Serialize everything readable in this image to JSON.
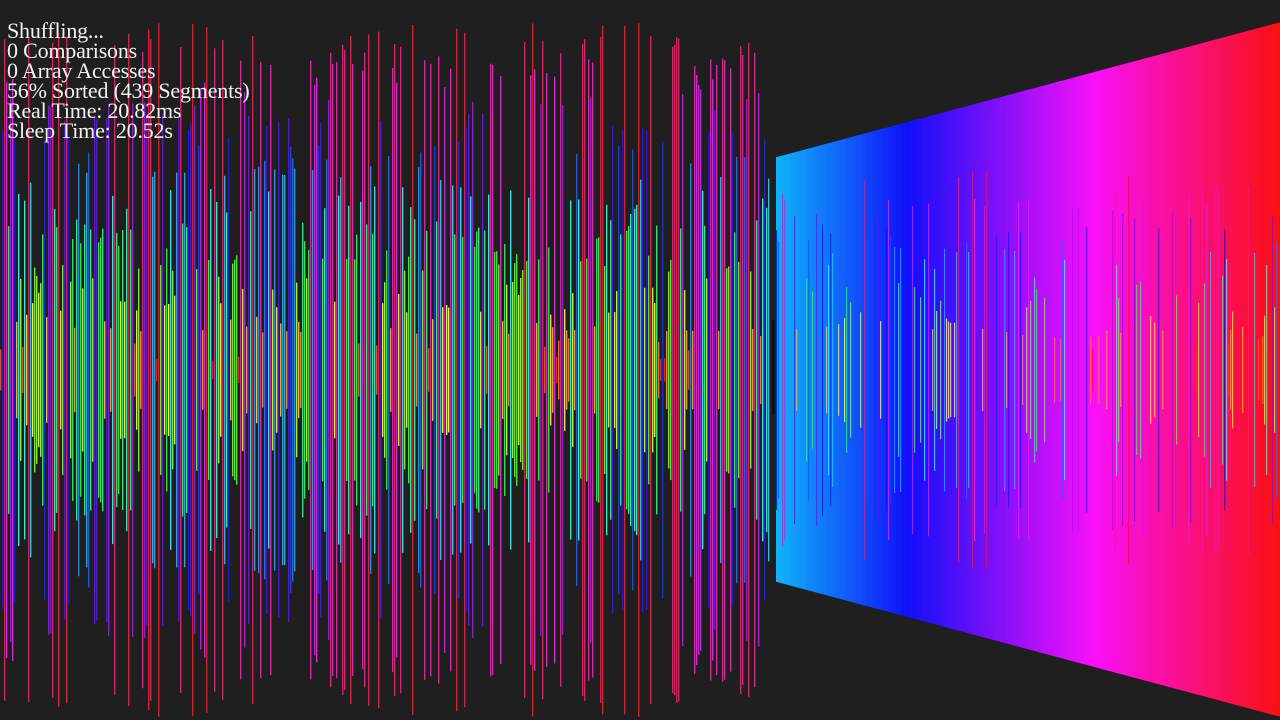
{
  "window": {
    "background": "#1f1f1f"
  },
  "stats": {
    "status": "Shuffling...",
    "comparisons": "0 Comparisons",
    "array_accesses": "0 Array Accesses",
    "sorted": "56% Sorted (439 Segments)",
    "real_time": "Real Time: 20.82ms",
    "sleep_time": "Sleep Time: 20.52s",
    "text_color": "#f2f2f2"
  },
  "visualization": {
    "style": "mirrored-bars-with-perspective",
    "color_scheme": "rainbow hue by value",
    "shuffled_region_fraction": 0.6,
    "sorted_run_value_range": [
      0.55,
      1.0
    ]
  }
}
